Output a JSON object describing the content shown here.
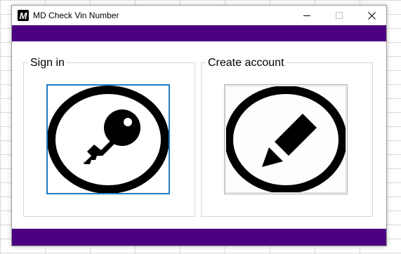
{
  "window": {
    "title": "MD Check Vin Number",
    "app_icon_text": "M",
    "controls": {
      "minimize_icon": "minimize-icon",
      "maximize_icon": "maximize-icon",
      "close_icon": "close-icon"
    }
  },
  "colors": {
    "accent_bar": "#4b0082",
    "focus_border": "#1e7bc6",
    "icon_fill": "#000000"
  },
  "groups": {
    "signin": {
      "legend": "Sign in",
      "button_icon": "key-circle-icon"
    },
    "create": {
      "legend": "Create account",
      "button_icon": "pencil-circle-icon"
    }
  }
}
